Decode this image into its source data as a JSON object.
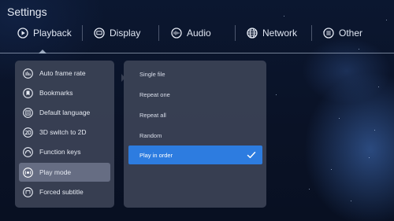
{
  "title": "Settings",
  "tabs": [
    {
      "label": "Playback",
      "icon": "play-circle-icon"
    },
    {
      "label": "Display",
      "icon": "display-icon"
    },
    {
      "label": "Audio",
      "icon": "audio-icon"
    },
    {
      "label": "Network",
      "icon": "globe-icon"
    },
    {
      "label": "Other",
      "icon": "menu-circle-icon"
    }
  ],
  "menu": [
    {
      "label": "Auto frame rate",
      "icon": "frame-rate-icon"
    },
    {
      "label": "Bookmarks",
      "icon": "bookmark-icon"
    },
    {
      "label": "Default language",
      "icon": "language-icon"
    },
    {
      "label": "3D switch to 2D",
      "icon": "2d-icon"
    },
    {
      "label": "Function keys",
      "icon": "function-keys-icon"
    },
    {
      "label": "Play mode",
      "icon": "play-mode-icon"
    },
    {
      "label": "Forced subtitle",
      "icon": "subtitle-icon"
    }
  ],
  "play_mode_options": [
    {
      "label": "Single file"
    },
    {
      "label": "Repeat one"
    },
    {
      "label": "Repeat all"
    },
    {
      "label": "Random"
    },
    {
      "label": "Play in order",
      "selected": true
    }
  ],
  "colors": {
    "accent": "#2d7ce0",
    "panel": "#3a4154",
    "selected_item": "#6e768c"
  }
}
